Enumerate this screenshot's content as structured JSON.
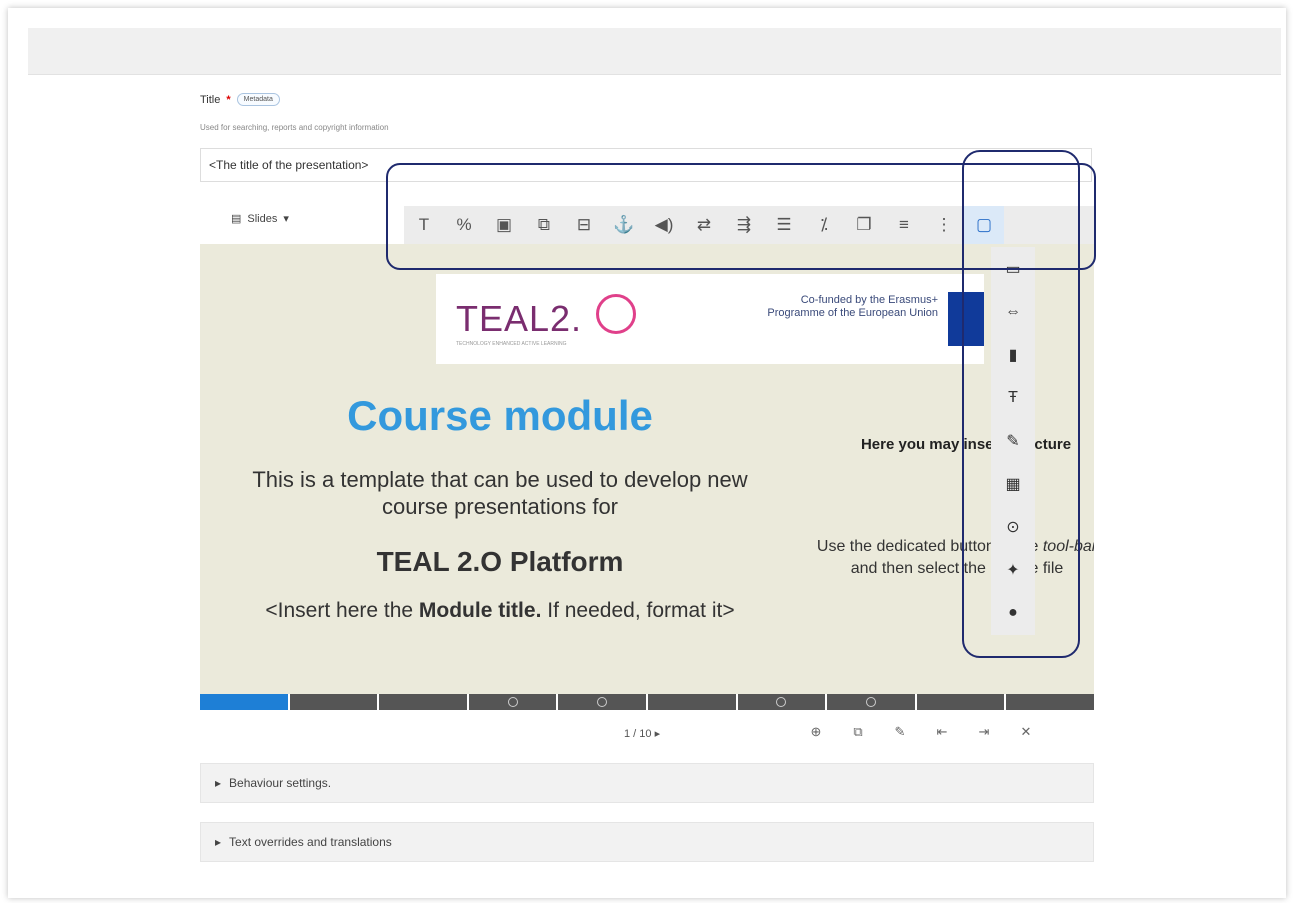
{
  "title_field": {
    "label": "Title",
    "required_mark": "*",
    "metadata_button": "Metadata",
    "description": "Used for searching, reports and copyright information",
    "value": "<The title of the presentation>"
  },
  "slides_dropdown": {
    "label": "Slides",
    "caret": "▾"
  },
  "toolbar": {
    "buttons": [
      {
        "icon": "text-icon",
        "glyph": "T"
      },
      {
        "icon": "link-icon",
        "glyph": "%"
      },
      {
        "icon": "image-icon",
        "glyph": "▣"
      },
      {
        "icon": "shapes-icon",
        "glyph": "⧉"
      },
      {
        "icon": "video-icon",
        "glyph": "⊟"
      },
      {
        "icon": "anchor-icon",
        "glyph": "⚓"
      },
      {
        "icon": "audio-icon",
        "glyph": "◀)"
      },
      {
        "icon": "fill-in-blanks-icon",
        "glyph": "⇄"
      },
      {
        "icon": "single-choice-icon",
        "glyph": "⇶"
      },
      {
        "icon": "multiple-choice-icon",
        "glyph": "☰"
      },
      {
        "icon": "true-false-icon",
        "glyph": "⁒"
      },
      {
        "icon": "dialog-cards-icon",
        "glyph": "❐"
      },
      {
        "icon": "summary-icon",
        "glyph": "≡"
      },
      {
        "icon": "more-options-icon",
        "glyph": "⋮"
      },
      {
        "icon": "slide-background-icon",
        "glyph": "▢"
      }
    ]
  },
  "more_menu": {
    "items": [
      {
        "icon": "interactive-video-icon",
        "glyph": "▭"
      },
      {
        "icon": "drag-text-icon",
        "glyph": "⇔"
      },
      {
        "icon": "cards-icon",
        "glyph": "▮"
      },
      {
        "icon": "mark-words-icon",
        "glyph": "Ŧ"
      },
      {
        "icon": "essay-icon",
        "glyph": "✎"
      },
      {
        "icon": "table-icon",
        "glyph": "▦"
      },
      {
        "icon": "go-to-slide-icon",
        "glyph": "⊙"
      },
      {
        "icon": "twitter-icon",
        "glyph": "✦"
      },
      {
        "icon": "audio-recorder-icon",
        "glyph": "●"
      }
    ]
  },
  "slide": {
    "logo_text": "TEAL2.",
    "logo_subtext": "TECHNOLOGY ENHANCED ACTIVE LEARNING",
    "eu_text": "Co-funded by the Erasmus+ Programme of the European Union",
    "main_title": "Course module",
    "body": "This is a template that can be used to develop new course presentations for",
    "platform": "TEAL 2.O Platform",
    "insert_prefix": "<Insert here the ",
    "insert_bold": "Module title.",
    "insert_suffix": " If needed, format it>",
    "right_title": "Here you may insert a picture",
    "right_body_1": "Use the dedicated button in the ",
    "right_body_tool": "tool-bar",
    "right_body_2": " and then select the picture file"
  },
  "progress": {
    "total": 10,
    "current": 1,
    "marked": [
      4,
      5,
      7,
      8
    ]
  },
  "nav": {
    "label": "1 / 10",
    "next": "▸"
  },
  "footer_actions": [
    {
      "icon": "add-slide-icon",
      "glyph": "⊕"
    },
    {
      "icon": "clone-slide-icon",
      "glyph": "⧉"
    },
    {
      "icon": "edit-background-icon",
      "glyph": "✎"
    },
    {
      "icon": "move-left-icon",
      "glyph": "⇤"
    },
    {
      "icon": "move-right-icon",
      "glyph": "⇥"
    },
    {
      "icon": "delete-slide-icon",
      "glyph": "✕"
    }
  ],
  "sections": {
    "behaviour": "Behaviour settings.",
    "overrides": "Text overrides and translations",
    "caret": "▸"
  },
  "colors": {
    "accent": "#3399dd",
    "progress_active": "#1e7fd6",
    "annotation": "#1f2a6e"
  }
}
